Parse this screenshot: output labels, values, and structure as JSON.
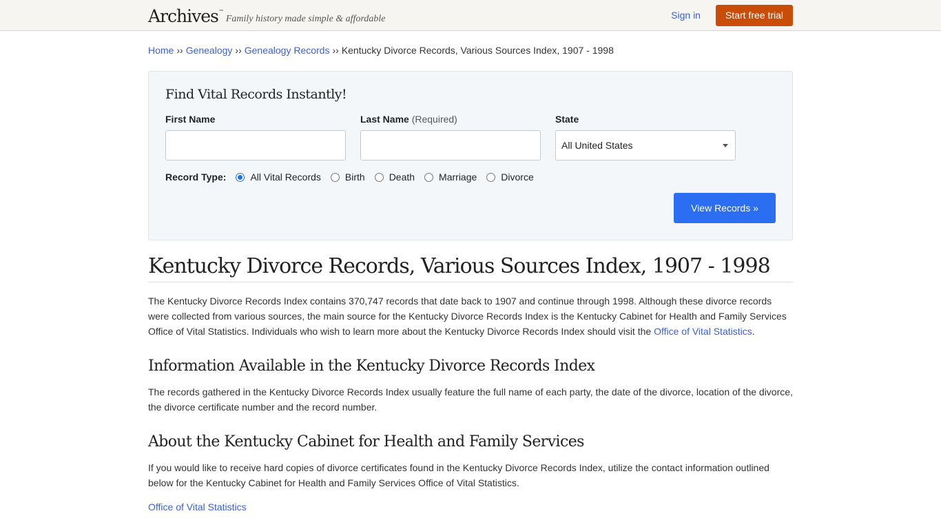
{
  "header": {
    "logo": "Archives",
    "logo_tm": "™",
    "tagline": "Family history made simple & affordable",
    "sign_in": "Sign in",
    "start_trial": "Start free trial"
  },
  "breadcrumb": {
    "separator": "››",
    "items": [
      {
        "label": "Home"
      },
      {
        "label": "Genealogy"
      },
      {
        "label": "Genealogy Records"
      }
    ],
    "current": "Kentucky Divorce Records, Various Sources Index, 1907 - 1998"
  },
  "search": {
    "title": "Find Vital Records Instantly!",
    "first_name_label": "First Name",
    "first_name_value": "",
    "last_name_label": "Last Name",
    "last_name_required": "(Required)",
    "last_name_value": "",
    "state_label": "State",
    "state_selected": "All United States",
    "record_type_label": "Record Type:",
    "record_types": [
      {
        "label": "All Vital Records",
        "checked": true
      },
      {
        "label": "Birth",
        "checked": false
      },
      {
        "label": "Death",
        "checked": false
      },
      {
        "label": "Marriage",
        "checked": false
      },
      {
        "label": "Divorce",
        "checked": false
      }
    ],
    "submit": "View Records »"
  },
  "article": {
    "title": "Kentucky Divorce Records, Various Sources Index, 1907 - 1998",
    "intro": "The Kentucky Divorce Records Index contains 370,747 records that date back to 1907 and continue through 1998. Although these divorce records were collected from various sources, the main source for the Kentucky Divorce Records Index is the Kentucky Cabinet for Health and Family Services Office of Vital Statistics. Individuals who wish to learn more about the Kentucky Divorce Records Index should visit the ",
    "intro_link": "Office of Vital Statistics",
    "intro_end": ".",
    "section1_title": "Information Available in the Kentucky Divorce Records Index",
    "section1_text": "The records gathered in the Kentucky Divorce Records Index usually feature the full name of each party, the date of the divorce, location of the divorce, the divorce certificate number and the record number.",
    "section2_title": "About the Kentucky Cabinet for Health and Family Services",
    "section2_text": "If you would like to receive hard copies of divorce certificates found in the Kentucky Divorce Records Index, utilize the contact information outlined below for the Kentucky Cabinet for Health and Family Services Office of Vital Statistics.",
    "bottom_link": "Office of Vital Statistics"
  }
}
